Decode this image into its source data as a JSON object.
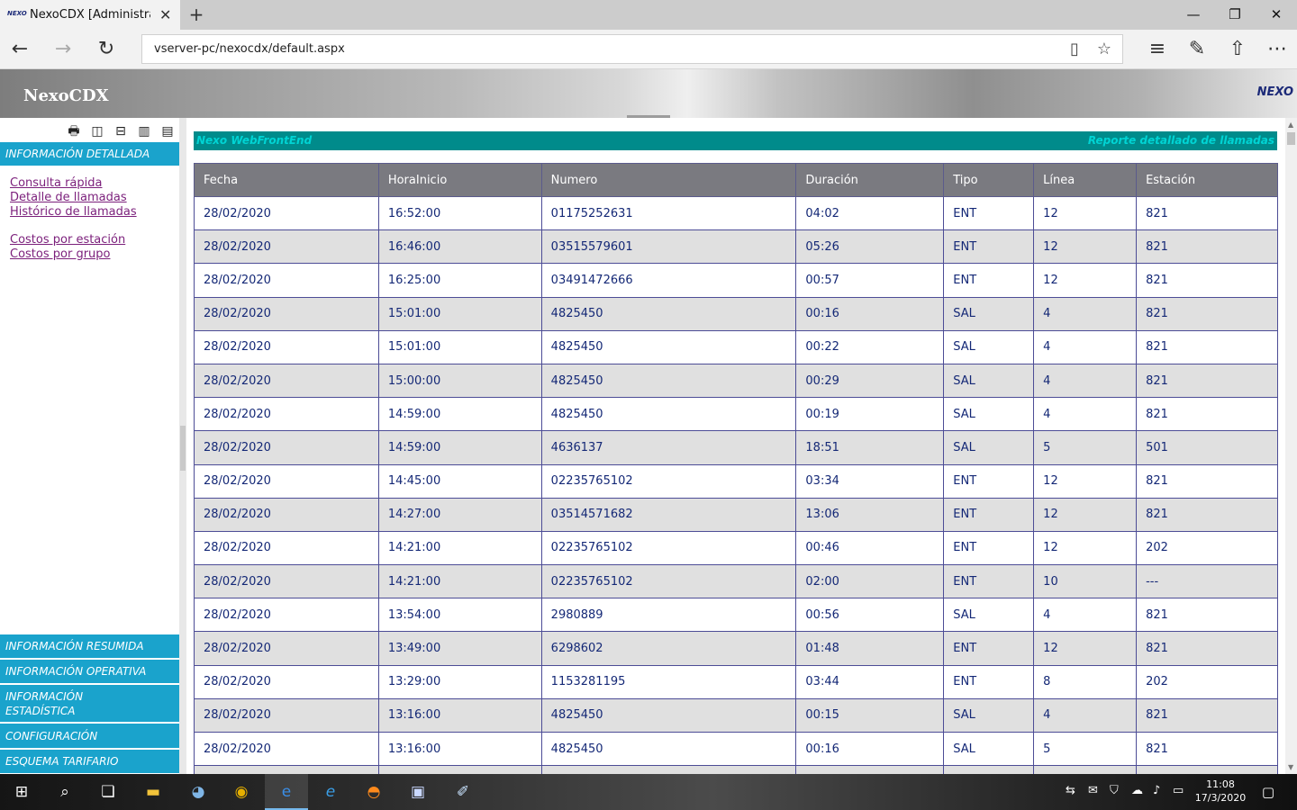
{
  "browser": {
    "tab_title": "NexoCDX [Administrado",
    "tab_favicon": "nexo-favicon-icon",
    "url": "vserver-pc/nexocdx/default.aspx",
    "newtab_label": "+"
  },
  "app": {
    "title": "NexoCDX",
    "logo_text": "NEXO"
  },
  "sidebar": {
    "toolbar": [
      "printer-icon",
      "columns-icon",
      "rows-icon",
      "books-icon",
      "notes-icon"
    ],
    "top_section": "INFORMACIÓN DETALLADA",
    "links_group1": [
      "Consulta rápida",
      "Detalle de llamadas",
      "Histórico de llamadas"
    ],
    "links_group2": [
      "Costos por estación",
      "Costos por grupo"
    ],
    "sections": [
      "INFORMACIÓN RESUMIDA",
      "INFORMACIÓN OPERATIVA",
      "INFORMACIÓN ESTADÍSTICA",
      "CONFIGURACIÓN",
      "ESQUEMA TARIFARIO"
    ]
  },
  "banner": {
    "left": "Nexo WebFrontEnd",
    "right": "Reporte detallado de llamadas"
  },
  "table": {
    "columns": [
      "Fecha",
      "HoraInicio",
      "Numero",
      "Duración",
      "Tipo",
      "Línea",
      "Estación"
    ],
    "rows": [
      [
        "28/02/2020",
        "16:52:00",
        "01175252631",
        "04:02",
        "ENT",
        "12",
        "821"
      ],
      [
        "28/02/2020",
        "16:46:00",
        "03515579601",
        "05:26",
        "ENT",
        "12",
        "821"
      ],
      [
        "28/02/2020",
        "16:25:00",
        "03491472666",
        "00:57",
        "ENT",
        "12",
        "821"
      ],
      [
        "28/02/2020",
        "15:01:00",
        "4825450",
        "00:16",
        "SAL",
        "4",
        "821"
      ],
      [
        "28/02/2020",
        "15:01:00",
        "4825450",
        "00:22",
        "SAL",
        "4",
        "821"
      ],
      [
        "28/02/2020",
        "15:00:00",
        "4825450",
        "00:29",
        "SAL",
        "4",
        "821"
      ],
      [
        "28/02/2020",
        "14:59:00",
        "4825450",
        "00:19",
        "SAL",
        "4",
        "821"
      ],
      [
        "28/02/2020",
        "14:59:00",
        "4636137",
        "18:51",
        "SAL",
        "5",
        "501"
      ],
      [
        "28/02/2020",
        "14:45:00",
        "02235765102",
        "03:34",
        "ENT",
        "12",
        "821"
      ],
      [
        "28/02/2020",
        "14:27:00",
        "03514571682",
        "13:06",
        "ENT",
        "12",
        "821"
      ],
      [
        "28/02/2020",
        "14:21:00",
        "02235765102",
        "00:46",
        "ENT",
        "12",
        "202"
      ],
      [
        "28/02/2020",
        "14:21:00",
        "02235765102",
        "02:00",
        "ENT",
        "10",
        "---"
      ],
      [
        "28/02/2020",
        "13:54:00",
        "2980889",
        "00:56",
        "SAL",
        "4",
        "821"
      ],
      [
        "28/02/2020",
        "13:49:00",
        "6298602",
        "01:48",
        "ENT",
        "12",
        "821"
      ],
      [
        "28/02/2020",
        "13:29:00",
        "1153281195",
        "03:44",
        "ENT",
        "8",
        "202"
      ],
      [
        "28/02/2020",
        "13:16:00",
        "4825450",
        "00:15",
        "SAL",
        "4",
        "821"
      ],
      [
        "28/02/2020",
        "13:16:00",
        "4825450",
        "00:16",
        "SAL",
        "5",
        "821"
      ],
      [
        "",
        "",
        "",
        "",
        "",
        "",
        ""
      ]
    ]
  },
  "taskbar": {
    "clock_time": "11:08",
    "clock_date": "17/3/2020"
  },
  "colors": {
    "menu_blue": "#1aa3cc",
    "banner_teal": "#008b8b",
    "banner_text": "#00d4d4",
    "header_gray": "#7a7a80",
    "row_alt": "#e0e0e0",
    "link_purple": "#7b1f7b"
  }
}
